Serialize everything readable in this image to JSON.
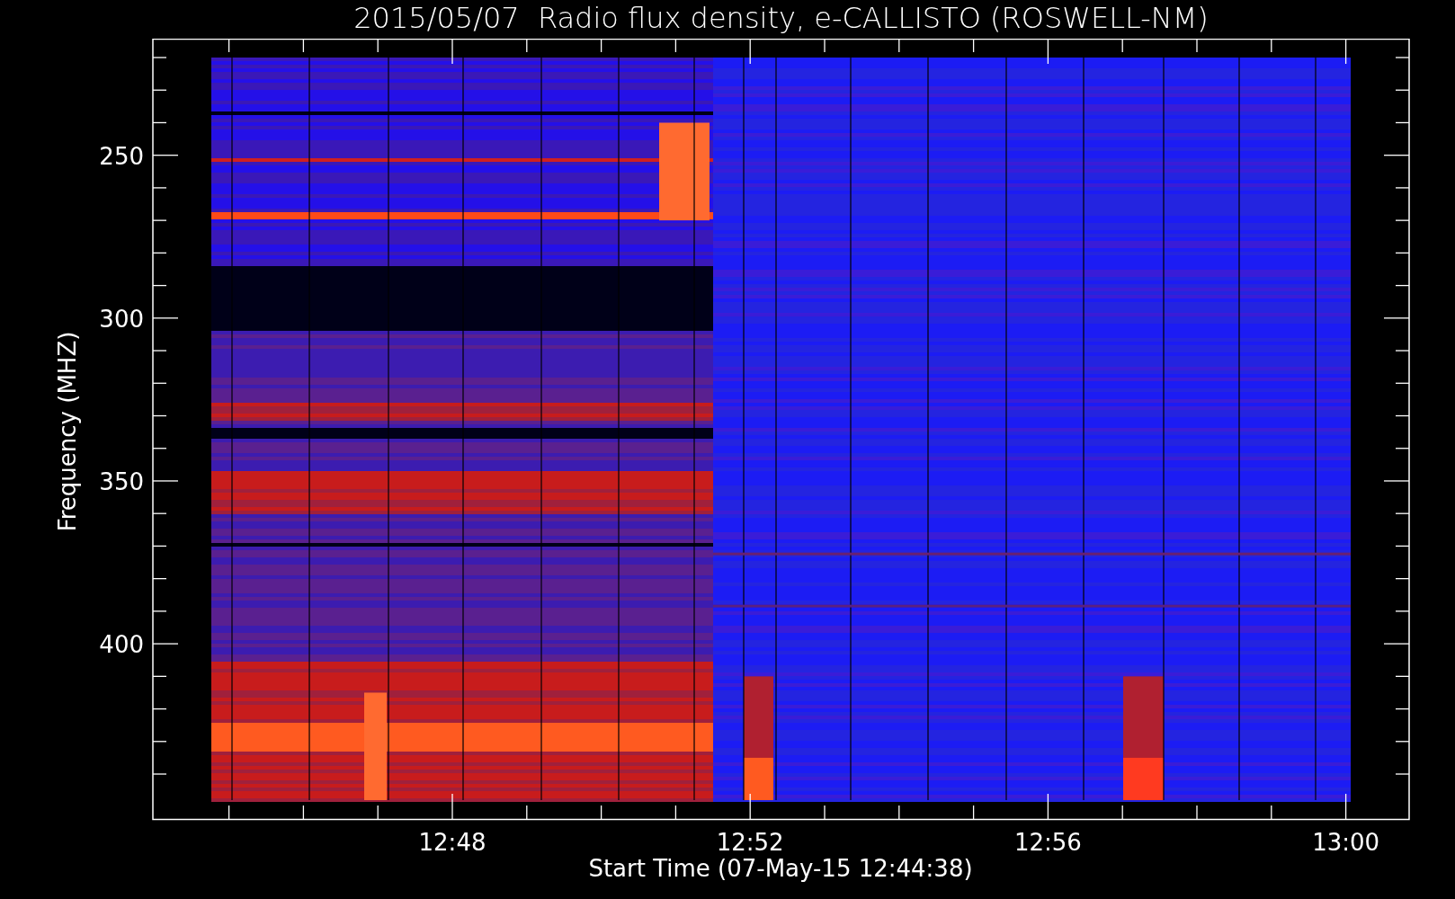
{
  "title": "2015/05/07  Radio flux density, e-CALLISTO (ROSWELL-NM)",
  "y_axis": {
    "title": "Frequency (MHZ)",
    "tick_labels": [
      "250",
      "300",
      "350",
      "400"
    ]
  },
  "x_axis": {
    "title": "Start Time (07-May-15 12:44:38)",
    "tick_labels": [
      "12:48",
      "12:52",
      "12:56",
      "13:00"
    ]
  }
}
